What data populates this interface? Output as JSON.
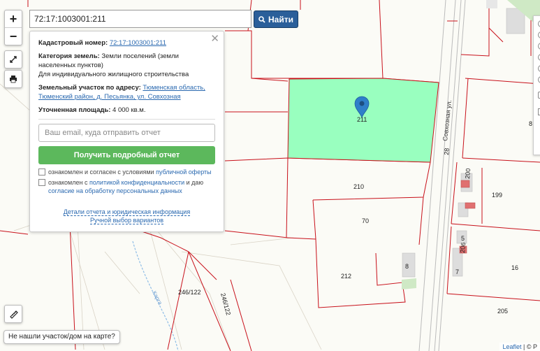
{
  "search": {
    "value": "72:17:1003001:211",
    "button_label": "Найти"
  },
  "panel": {
    "cadastral_label": "Кадастровый номер:",
    "cadastral_number": "72:17:1003001:211",
    "category_label": "Категория земель:",
    "category_value": "Земли поселений (земли населенных пунктов)",
    "usage_value": "Для индивидуального жилищного строительства",
    "address_label": "Земельный участок по адресу:",
    "address_value": "Тюменская область, Тюменский район, д. Песьянка, ул. Совхозная",
    "area_label": "Уточненная площадь:",
    "area_value": "4 000 кв.м.",
    "email_placeholder": "Ваш email, куда отправить отчет",
    "report_button": "Получить подробный отчет",
    "agree1_text": "ознакомлен и согласен с условиями",
    "agree1_link": "публичной оферты",
    "agree2_text": "ознакомлен с",
    "agree2_link1": "политикой конфиденциальности",
    "agree2_mid": "и даю",
    "agree2_link2": "согласие на обработку персональных данных",
    "details_link": "Детали отчета и юридическая информация",
    "manual_link": "Ручной выбор вариантов"
  },
  "map": {
    "parcel_labels": {
      "p211": "211",
      "p210": "210",
      "p70": "70",
      "p212": "212",
      "p8": "8",
      "p200": "200",
      "p199": "199",
      "p5": "5",
      "p206": "206",
      "p7": "7",
      "p16": "16",
      "p205": "205",
      "p246a": "246/122",
      "p246b": "246/122",
      "p28": "28",
      "p8r": "8"
    },
    "street_label": "Совхозная ул.",
    "river_label": "Карга",
    "highlight_color": "#99ffbf",
    "parcel_border_color": "#c8101a"
  },
  "not_found_label": "Не нашли участок/дом на карте?",
  "attribution": {
    "link": "Leaflet",
    "rest": "| © Р"
  }
}
